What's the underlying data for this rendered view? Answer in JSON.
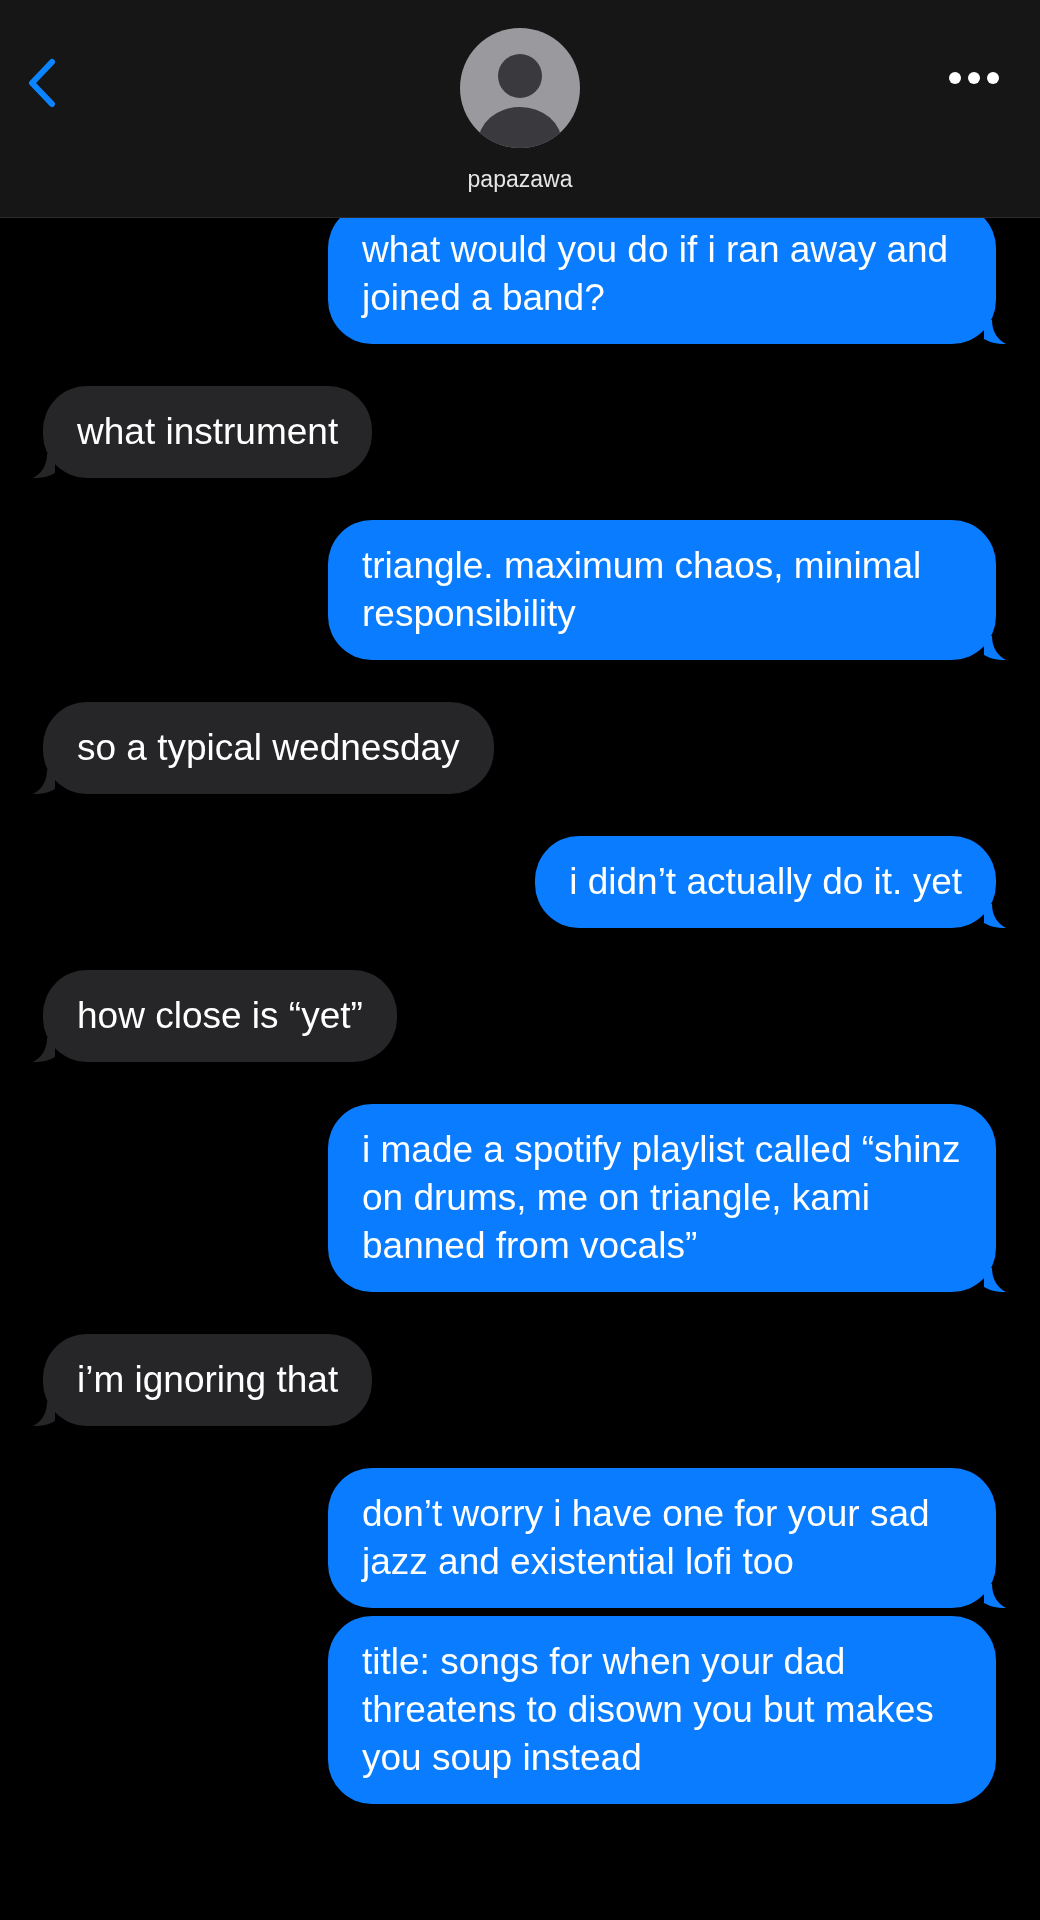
{
  "header": {
    "contact_name": "papazawa"
  },
  "messages": [
    {
      "kind": "sent",
      "text": "what would you do if i ran away and joined a band?",
      "tail": true
    },
    {
      "kind": "received",
      "text": "what instrument",
      "tail": true
    },
    {
      "kind": "sent",
      "text": "triangle. maximum chaos, minimal responsibility",
      "tail": true
    },
    {
      "kind": "received",
      "text": "so a typical wednesday",
      "tail": true
    },
    {
      "kind": "sent",
      "text": "i didn’t actually do it. yet",
      "tail": true
    },
    {
      "kind": "received",
      "text": "how close is “yet”",
      "tail": true
    },
    {
      "kind": "sent",
      "text": "i made a spotify playlist called “shinz on drums, me on triangle, kami banned from vocals”",
      "tail": true
    },
    {
      "kind": "received",
      "text": "i’m ignoring that",
      "tail": true
    },
    {
      "kind": "sent",
      "text": "don’t worry i have one for your sad jazz and existential lofi too",
      "tail": true
    },
    {
      "kind": "sent",
      "text": "title: songs for when your dad threatens to disown you but makes you soup instead",
      "tail": false
    }
  ]
}
